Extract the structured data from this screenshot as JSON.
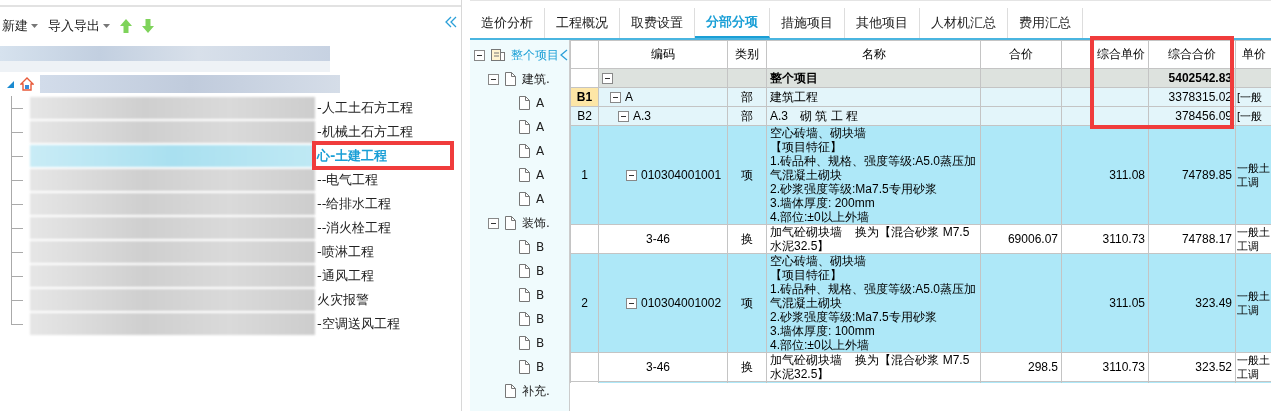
{
  "left_panel": {
    "toolbar": [
      {
        "kind": "menu",
        "label": "新建"
      },
      {
        "kind": "menu",
        "label": "导入导出"
      },
      {
        "kind": "up"
      },
      {
        "kind": "down"
      }
    ],
    "tree": {
      "expanded": true,
      "children": [
        {
          "label": "-人工土石方工程",
          "selected": false
        },
        {
          "label": "-机械土石方工程",
          "selected": false
        },
        {
          "label": "心-土建工程",
          "selected": true
        },
        {
          "label": "--电气工程",
          "selected": false
        },
        {
          "label": "--给排水工程",
          "selected": false
        },
        {
          "label": "--消火栓工程",
          "selected": false
        },
        {
          "label": "-喷淋工程",
          "selected": false
        },
        {
          "label": "-通风工程",
          "selected": false
        },
        {
          "label": "火灾报警",
          "selected": false
        },
        {
          "label": "-空调送风工程",
          "selected": false
        }
      ]
    }
  },
  "project_tree": {
    "label": "整个项目",
    "selected": true,
    "expanded": true,
    "children": [
      {
        "label": "建筑.",
        "selected": false,
        "expanded": true,
        "children": [
          {
            "label": "A",
            "selected": false
          },
          {
            "label": "A",
            "selected": false
          },
          {
            "label": "A",
            "selected": false
          },
          {
            "label": "A",
            "selected": false
          },
          {
            "label": "A",
            "selected": false
          }
        ]
      },
      {
        "label": "装饰.",
        "selected": false,
        "expanded": true,
        "children": [
          {
            "label": "B",
            "selected": false
          },
          {
            "label": "B",
            "selected": false
          },
          {
            "label": "B",
            "selected": false
          },
          {
            "label": "B",
            "selected": false
          },
          {
            "label": "B",
            "selected": false
          },
          {
            "label": "B",
            "selected": false
          }
        ]
      },
      {
        "label": "补充.",
        "selected": false
      }
    ]
  },
  "tabs": [
    {
      "label": "造价分析",
      "selected": false
    },
    {
      "label": "工程概况",
      "selected": false
    },
    {
      "label": "取费设置",
      "selected": false
    },
    {
      "label": "分部分项",
      "selected": true
    },
    {
      "label": "措施项目",
      "selected": false
    },
    {
      "label": "其他项目",
      "selected": false
    },
    {
      "label": "人材机汇总",
      "selected": false
    },
    {
      "label": "费用汇总",
      "selected": false
    }
  ],
  "grid": {
    "columns": [
      "编码",
      "类别",
      "名称",
      "合价",
      "综合单价",
      "综合合价",
      "单价"
    ],
    "rows": [
      {
        "kind": "root",
        "selected": false,
        "expanded": true,
        "name": "整个项目",
        "combined_total": "5402542.83",
        "children": [
          {
            "kind": "section",
            "selected": true,
            "expanded": true,
            "num": "B1",
            "code": "A",
            "type": "部",
            "name": "建筑工程",
            "combined_total": "3378315.02",
            "column_7": "[一般",
            "children": [
              {
                "kind": "section",
                "selected": false,
                "expanded": true,
                "num": "B2",
                "code": "A.3",
                "type": "部",
                "name": "A.3　砌 筑 工 程",
                "combined_total": "378456.09",
                "column_7": "[一般",
                "children": [
                  {
                    "kind": "item",
                    "selected": false,
                    "expanded": true,
                    "num": "1",
                    "code": "010304001001",
                    "type": "项",
                    "name_lines": [
                      "空心砖墙、砌块墙",
                      "【项目特征】",
                      "1.砖品种、规格、强度等级:A5.0蒸压加气混凝土砌块",
                      "2.砂浆强度等级:Ma7.5专用砂浆",
                      "3.墙体厚度: 200mm",
                      "4.部位:±0以上外墙"
                    ],
                    "unit_price": "311.08",
                    "combined_total": "74789.85",
                    "column_7": "一般土工调",
                    "children": [
                      {
                        "kind": "sub",
                        "selected": false,
                        "code": "3-46",
                        "type": "换",
                        "name": "加气砼砌块墙    换为【混合砂浆 M7.5 水泥32.5】",
                        "total": "69006.07",
                        "unit_price": "3110.73",
                        "combined_total": "74788.17",
                        "column_7": "一般土工调"
                      }
                    ]
                  },
                  {
                    "kind": "item",
                    "selected": false,
                    "expanded": true,
                    "num": "2",
                    "code": "010304001002",
                    "type": "项",
                    "name_lines": [
                      "空心砖墙、砌块墙",
                      "【项目特征】",
                      "1.砖品种、规格、强度等级:A5.0蒸压加气混凝土砌块",
                      "2.砂浆强度等级:Ma7.5专用砂浆",
                      "3.墙体厚度: 100mm",
                      "4.部位:±0以上外墙"
                    ],
                    "unit_price": "311.05",
                    "combined_total": "323.49",
                    "column_7": "一般土工调",
                    "children": [
                      {
                        "kind": "sub",
                        "selected": false,
                        "code": "3-46",
                        "type": "换",
                        "name": "加气砼砌块墙    换为【混合砂浆 M7.5 水泥32.5】",
                        "total": "298.5",
                        "unit_price": "3110.73",
                        "combined_total": "323.52",
                        "column_7": "一般土工调"
                      }
                    ]
                  }
                ]
              }
            ]
          }
        ]
      }
    ]
  },
  "annotations": [
    {
      "kind": "rect"
    },
    {
      "kind": "rect"
    }
  ]
}
